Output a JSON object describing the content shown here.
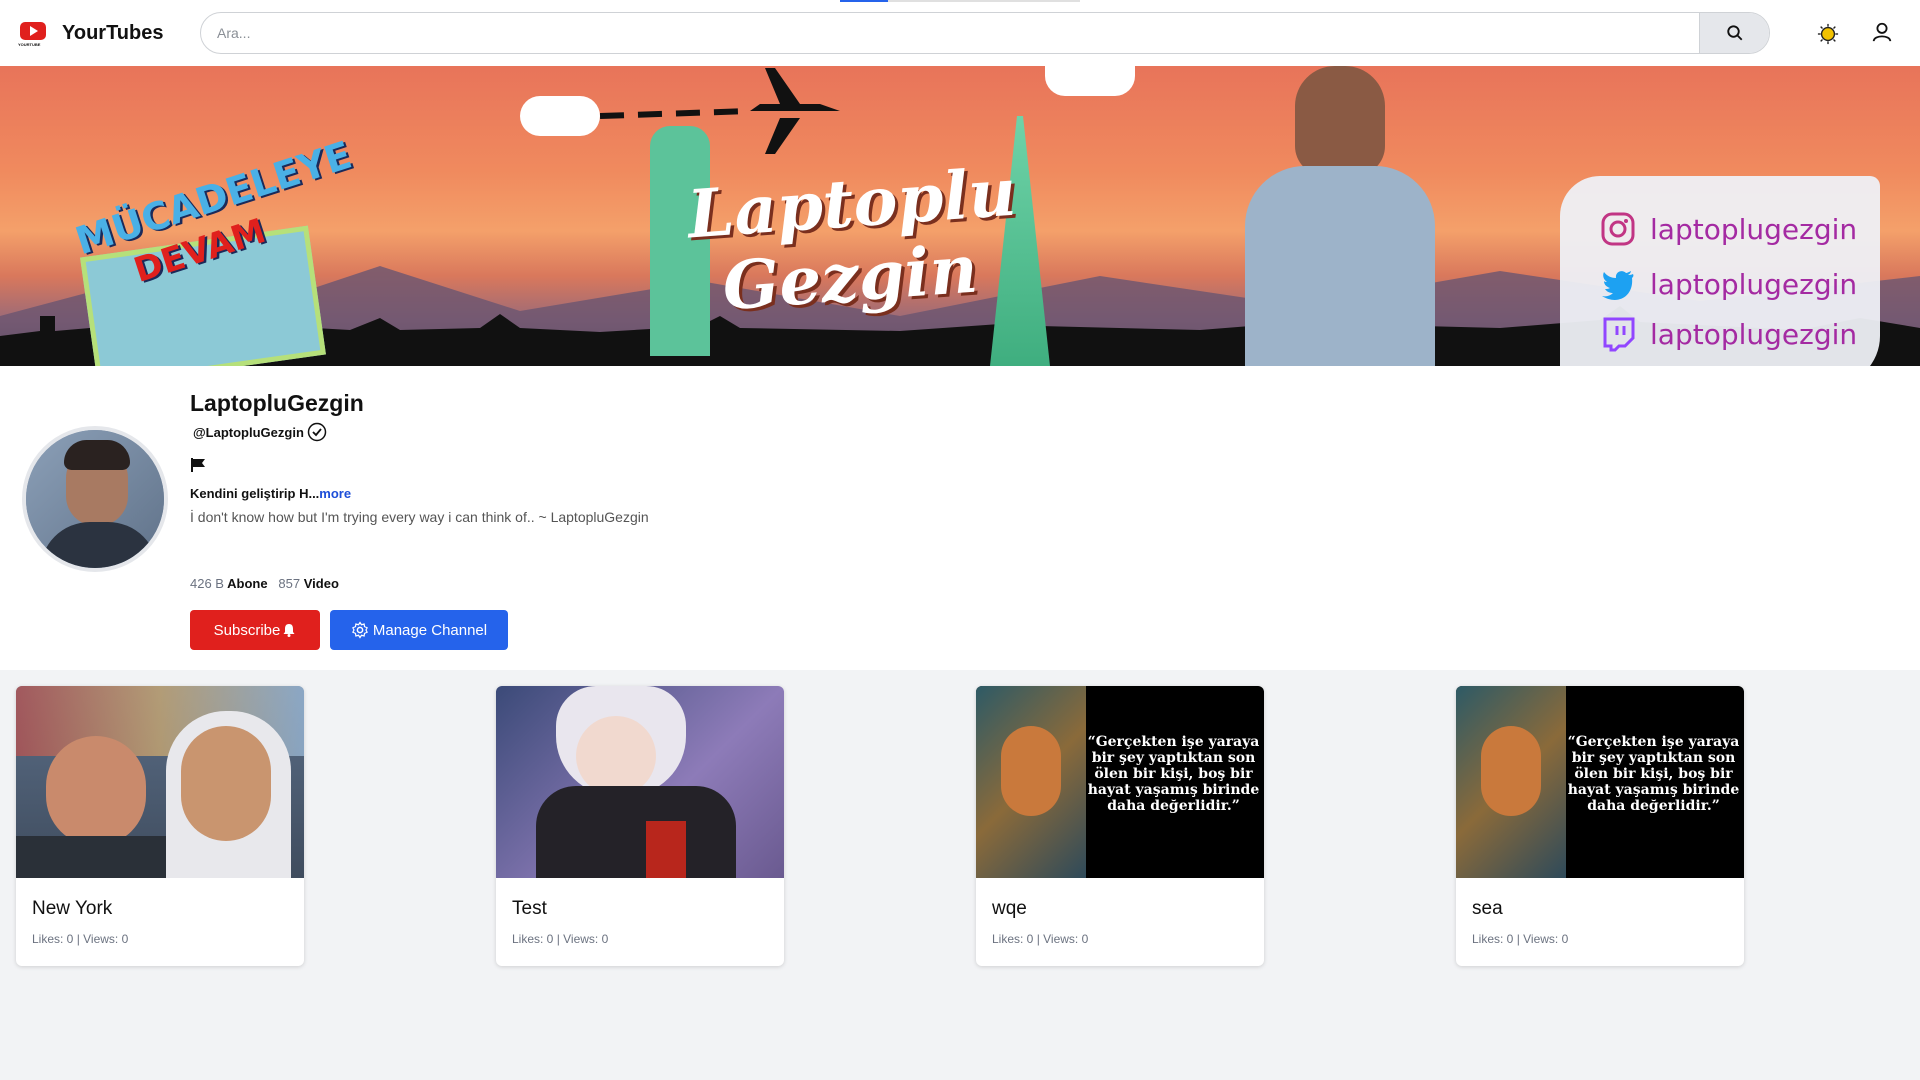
{
  "app": {
    "name": "YourTubes",
    "logo_caption": "YOURTUBE"
  },
  "search": {
    "placeholder": "Ara..."
  },
  "banner": {
    "badge_line1": "MÜCADELEYE",
    "badge_line2": "DEVAM",
    "title_line1": "Laptoplu",
    "title_line2": "Gezgin",
    "socials": [
      {
        "icon": "instagram-icon",
        "handle": "laptoplugezgin"
      },
      {
        "icon": "twitter-icon",
        "handle": "laptoplugezgin"
      },
      {
        "icon": "twitch-icon",
        "handle": "laptoplugezgin"
      }
    ]
  },
  "channel": {
    "name": "LaptopluGezgin",
    "handle": "@LaptopluGezgin",
    "description_short": "Kendini geliştirip H...",
    "more_label": "more",
    "description_long": "İ don't know how but I'm trying every way i can think of.. ~ LaptopluGezgin",
    "subscribers": "426 B",
    "subscribers_label": "Abone",
    "videos": "857",
    "videos_label": "Video"
  },
  "actions": {
    "subscribe_label": "Subscribe",
    "manage_label": "Manage Channel"
  },
  "videos": [
    {
      "title": "New York",
      "meta": "Likes: 0 | Views: 0",
      "thumb": "new-york"
    },
    {
      "title": "Test",
      "meta": "Likes: 0 | Views: 0",
      "thumb": "anime"
    },
    {
      "title": "wqe",
      "meta": "Likes: 0 | Views: 0",
      "thumb": "quote"
    },
    {
      "title": "sea",
      "meta": "Likes: 0 | Views: 0",
      "thumb": "quote"
    }
  ],
  "quote": {
    "l1": "“Gerçekten işe yaraya",
    "l2": "bir şey yaptıktan son",
    "l3": "ölen bir kişi, boş bir",
    "l4": "hayat yaşamış birinde",
    "l5": "daha değerlidir.”"
  },
  "colors": {
    "accent_red": "#e0201d",
    "accent_blue": "#2563eb",
    "social_purple": "#a42aa2"
  }
}
